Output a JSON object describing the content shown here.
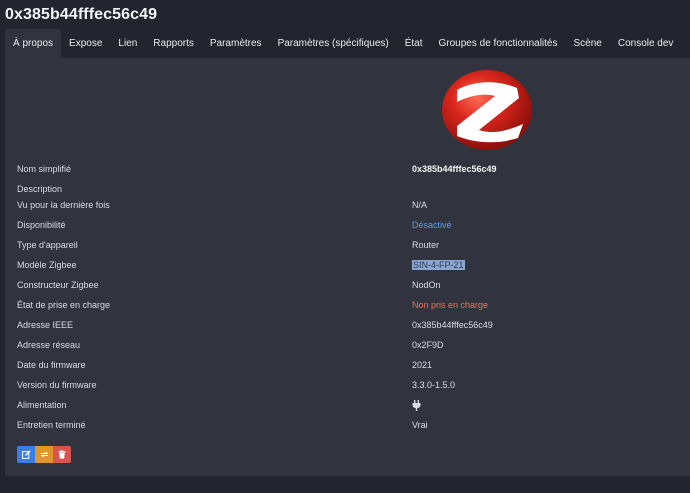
{
  "device": {
    "title": "0x385b44fffec56c49"
  },
  "tabs": [
    {
      "label": "À propos",
      "active": true
    },
    {
      "label": "Expose"
    },
    {
      "label": "Lien"
    },
    {
      "label": "Rapports"
    },
    {
      "label": "Paramètres"
    },
    {
      "label": "Paramètres (spécifiques)"
    },
    {
      "label": "État"
    },
    {
      "label": "Groupes de fonctionnalités"
    },
    {
      "label": "Scène"
    },
    {
      "label": "Console dev"
    }
  ],
  "logo": {
    "icon": "zigbee-logo-icon",
    "color": "#c8261e"
  },
  "rows": [
    {
      "label": "Nom simplifié",
      "value": "0x385b44fffec56c49"
    },
    {
      "label": "Description",
      "value": ""
    },
    {
      "label": "Vu pour la dernière fois",
      "value": "N/A"
    },
    {
      "label": "Disponibilité",
      "value": "Désactivé"
    },
    {
      "label": "Type d'appareil",
      "value": "Router"
    },
    {
      "label": "Modèle Zigbee",
      "value": "SIN-4-FP-21"
    },
    {
      "label": "Constructeur Zigbee",
      "value": "NodOn"
    },
    {
      "label": "État de prise en charge",
      "value": "Non pris en charge"
    },
    {
      "label": "Adresse IEEE",
      "value": "0x385b44fffec56c49"
    },
    {
      "label": "Adresse réseau",
      "value": "0x2F9D"
    },
    {
      "label": "Date du firmware",
      "value": "2021"
    },
    {
      "label": "Version du firmware",
      "value": "3.3.0-1.5.0"
    },
    {
      "label": "Alimentation",
      "value": "",
      "icon": "plug-icon"
    },
    {
      "label": "Entretien terminé",
      "value": "Vrai"
    }
  ],
  "actions": {
    "edit_icon": "edit-icon",
    "refresh_icon": "refresh-icon",
    "remove_icon": "trash-icon"
  },
  "colors": {
    "background": "#22252e",
    "panel": "#31343e",
    "link_blue": "#5b9cf6",
    "warning_red": "#f0705a",
    "edit_blue": "#3b7de1",
    "refresh_orange": "#e0962a",
    "remove_red": "#d9534f"
  }
}
